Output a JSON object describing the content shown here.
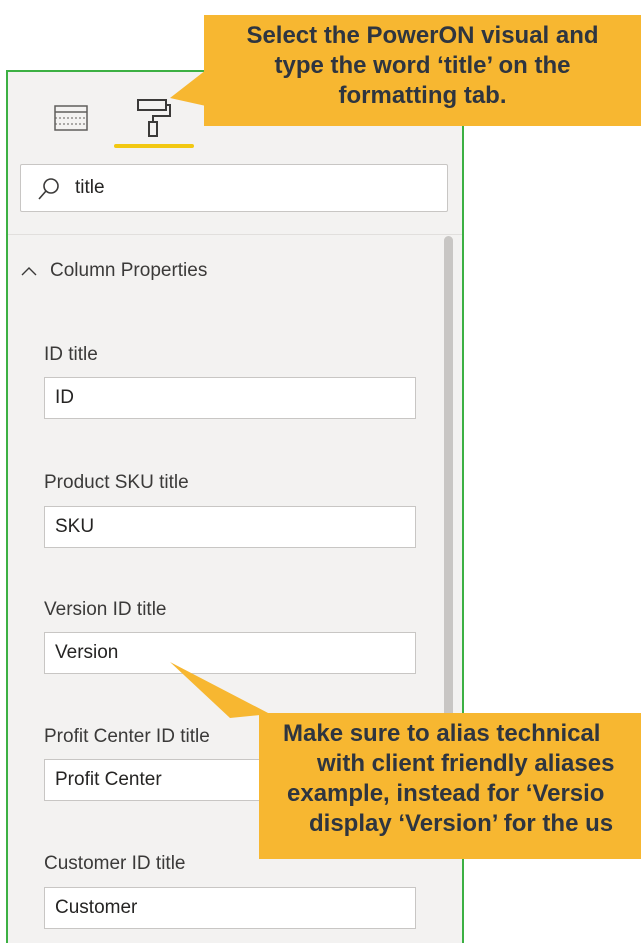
{
  "pane": {
    "tabs": [
      {
        "name": "fields",
        "icon": "fields-grid-icon"
      },
      {
        "name": "format",
        "icon": "paint-roller-icon",
        "active": true
      }
    ],
    "search": {
      "value": "title",
      "icon": "search-icon"
    },
    "section": {
      "label": "Column Properties",
      "icon": "chevron-up-icon"
    },
    "properties": [
      {
        "label": "ID title",
        "value": "ID"
      },
      {
        "label": "Product SKU title",
        "value": "SKU"
      },
      {
        "label": "Version ID title",
        "value": "Version"
      },
      {
        "label": "Profit Center ID title",
        "value": "Profit Center"
      },
      {
        "label": "Customer ID title",
        "value": "Customer"
      }
    ]
  },
  "callouts": {
    "top": [
      "Select the PowerON visual and",
      "type the word ‘title’ on the",
      "formatting tab."
    ],
    "bottom": [
      "Make sure to alias technical",
      "with client friendly aliases",
      "example, instead for ‘Versio",
      "display ‘Version’ for the us"
    ]
  },
  "colors": {
    "accent_tab": "#f2c811",
    "callout": "#f7b731",
    "pane_border": "#3cb043"
  }
}
